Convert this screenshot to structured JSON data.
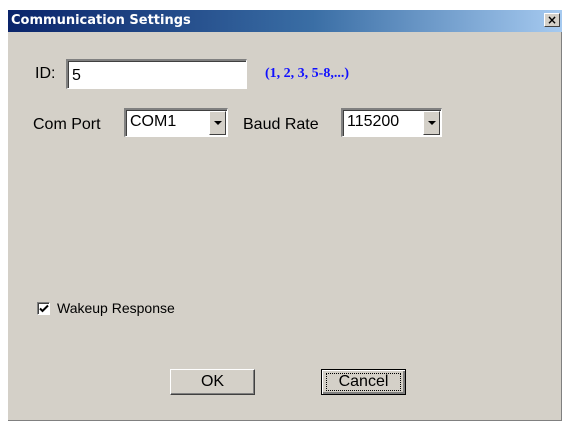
{
  "window": {
    "title": "Communication Settings",
    "close_symbol": "×"
  },
  "id_field": {
    "label": "ID:",
    "value": "5",
    "hint": "(1, 2, 3, 5-8,...)",
    "hint_color": "#1010ff"
  },
  "com_port": {
    "label": "Com Port",
    "selected": "COM1"
  },
  "baud_rate": {
    "label": "Baud Rate",
    "selected": "115200"
  },
  "wakeup": {
    "label": "Wakeup Response",
    "checked": true,
    "icon": "checkmark-icon"
  },
  "buttons": {
    "ok": "OK",
    "cancel": "Cancel"
  },
  "colors": {
    "title_bar_start": "#0a246a",
    "title_bar_end": "#a6caf0",
    "dialog_background": "#d4d0c8"
  }
}
